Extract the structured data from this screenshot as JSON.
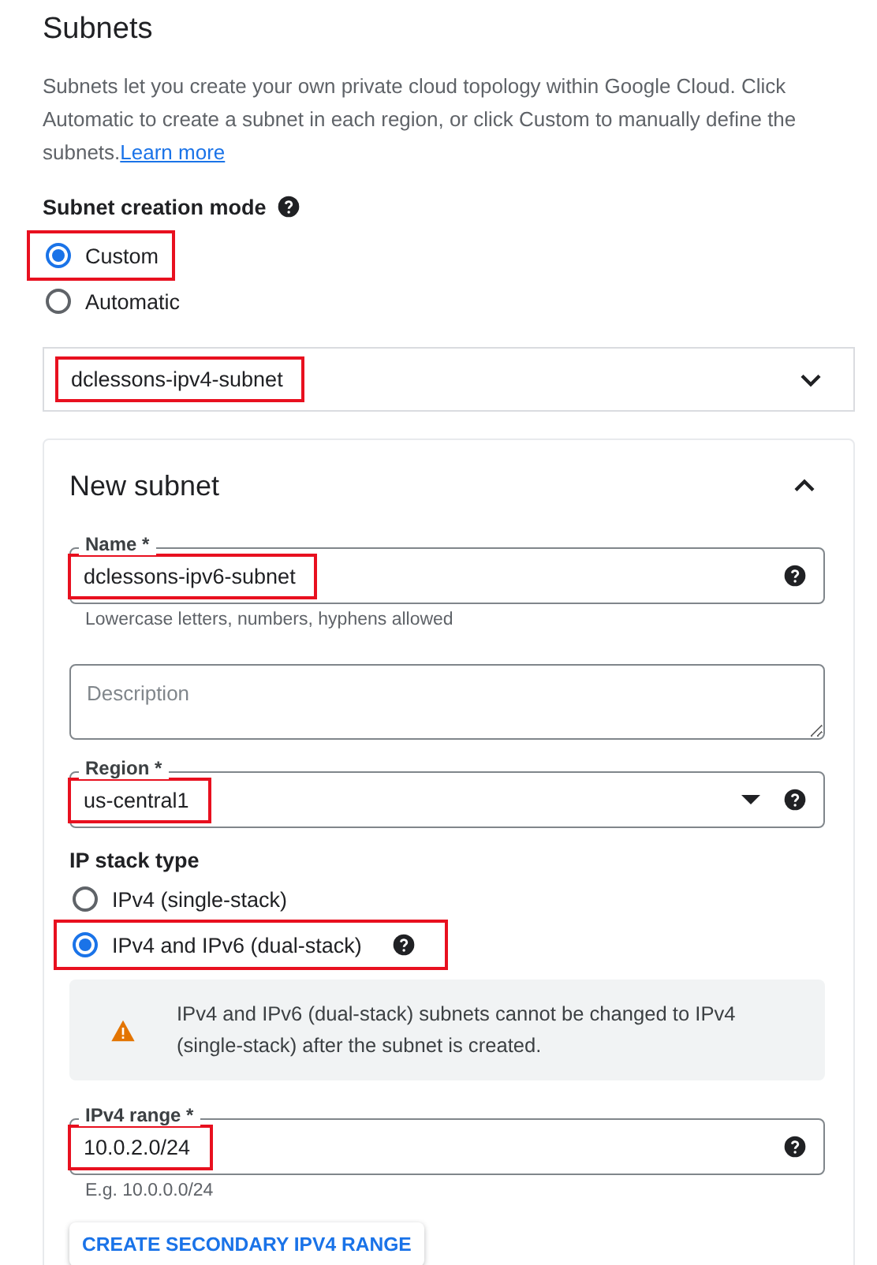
{
  "title": "Subnets",
  "description": "Subnets let you create your own private cloud topology within Google Cloud. Click Automatic to create a subnet in each region, or click Custom to manually define the subnets.",
  "learn_more": "Learn more",
  "creation_mode": {
    "label": "Subnet creation mode",
    "help_icon": true,
    "options": [
      {
        "label": "Custom",
        "selected": true,
        "highlighted": true
      },
      {
        "label": "Automatic",
        "selected": false,
        "highlighted": false
      }
    ]
  },
  "existing_subnets": [
    {
      "name": "dclessons-ipv4-subnet",
      "expanded": false,
      "highlighted": true
    }
  ],
  "new_subnet": {
    "title": "New subnet",
    "expanded": true,
    "items": [
      {
        "kind": "text",
        "label": "Name *",
        "value": "dclessons-ipv6-subnet",
        "help_icon": true,
        "hint": "Lowercase letters, numbers, hyphens allowed",
        "highlighted": true
      },
      {
        "kind": "textarea",
        "placeholder": "Description"
      },
      {
        "kind": "select",
        "label": "Region *",
        "value": "us-central1",
        "help_icon": true,
        "highlighted": true
      },
      {
        "kind": "radio_group",
        "label": "IP stack type",
        "options": [
          {
            "label": "IPv4 (single-stack)",
            "selected": false,
            "highlighted": false
          },
          {
            "label": "IPv4 and IPv6 (dual-stack)",
            "selected": true,
            "highlighted": true,
            "help_icon": true
          }
        ]
      },
      {
        "kind": "warning",
        "text": "IPv4 and IPv6 (dual-stack) subnets cannot be changed to IPv4 (single-stack) after the subnet is created."
      },
      {
        "kind": "text",
        "label": "IPv4 range *",
        "value": "10.0.2.0/24",
        "help_icon": true,
        "hint": "E.g. 10.0.0.0/24",
        "highlighted": true
      },
      {
        "kind": "button",
        "label": "CREATE SECONDARY IPV4 RANGE"
      }
    ]
  }
}
